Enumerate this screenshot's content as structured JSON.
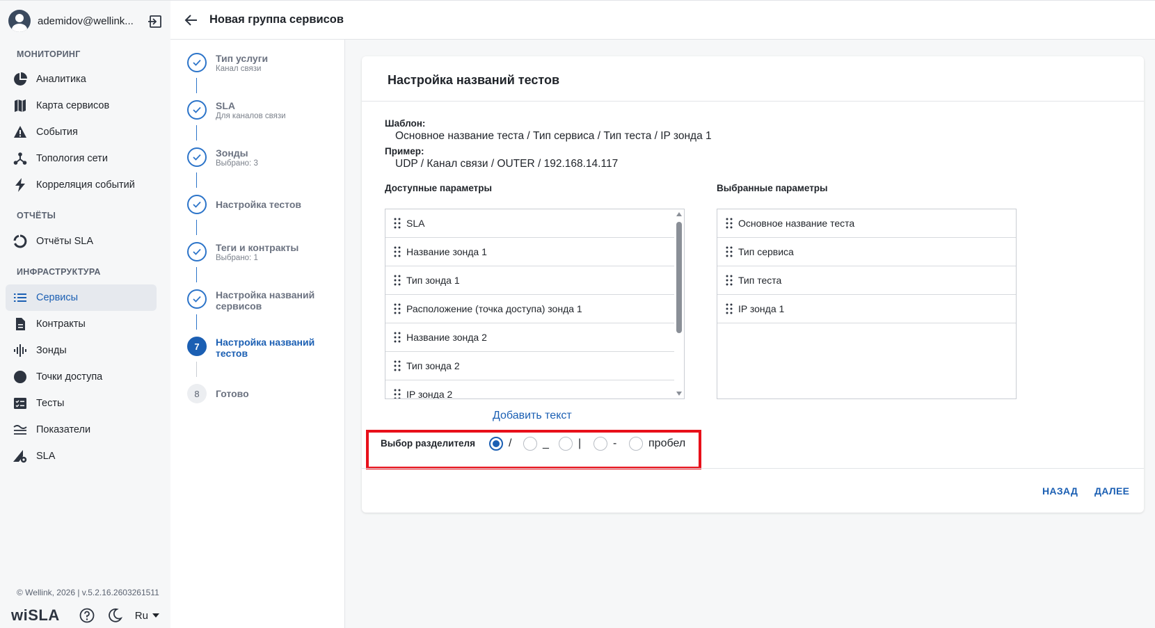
{
  "user": {
    "name": "ademidov@wellink..."
  },
  "sidebar": {
    "sections": [
      {
        "title": "МОНИТОРИНГ"
      },
      {
        "title": "ОТЧЁТЫ"
      },
      {
        "title": "ИНФРАСТРУКТУРА"
      }
    ],
    "items": [
      {
        "label": "Аналитика",
        "icon": "pie-chart-icon"
      },
      {
        "label": "Карта сервисов",
        "icon": "map-icon"
      },
      {
        "label": "События",
        "icon": "warning-icon"
      },
      {
        "label": "Топология сети",
        "icon": "topology-icon"
      },
      {
        "label": "Корреляция событий",
        "icon": "lightning-icon"
      },
      {
        "label": "Отчёты SLA",
        "icon": "circle-report-icon"
      },
      {
        "label": "Сервисы",
        "icon": "list-icon",
        "active": true
      },
      {
        "label": "Контракты",
        "icon": "document-icon"
      },
      {
        "label": "Зонды",
        "icon": "sound-wave-icon"
      },
      {
        "label": "Точки доступа",
        "icon": "dot-icon"
      },
      {
        "label": "Тесты",
        "icon": "checklist-icon"
      },
      {
        "label": "Показатели",
        "icon": "metrics-icon"
      },
      {
        "label": "SLA",
        "icon": "sla-gear-icon"
      }
    ],
    "footer": {
      "version": "© Wellink, 2026 | v.5.2.16.2603261511",
      "logo": "wiSLA",
      "lang": "Ru"
    }
  },
  "header": {
    "title": "Новая группа сервисов"
  },
  "stepper": {
    "steps": [
      {
        "title": "Тип услуги",
        "sub": "Канал связи",
        "state": "done"
      },
      {
        "title": "SLA",
        "sub": "Для каналов связи",
        "state": "done"
      },
      {
        "title": "Зонды",
        "sub": "Выбрано: 3",
        "state": "done"
      },
      {
        "title": "Настройка тестов",
        "sub": "",
        "state": "done"
      },
      {
        "title": "Теги и контракты",
        "sub": "Выбрано: 1",
        "state": "done"
      },
      {
        "title": "Настройка названий сервисов",
        "sub": "",
        "state": "done"
      },
      {
        "title": "Настройка названий тестов",
        "sub": "",
        "state": "active",
        "num": "7"
      },
      {
        "title": "Готово",
        "sub": "",
        "state": "pending",
        "num": "8"
      }
    ]
  },
  "card": {
    "title": "Настройка названий тестов",
    "template_label": "Шаблон:",
    "template_value": "Основное название теста / Тип сервиса / Тип теста / IP зонда 1",
    "example_label": "Пример:",
    "example_value": "UDP / Канал связи / OUTER / 192.168.14.117",
    "available_title": "Доступные параметры",
    "selected_title": "Выбранные параметры",
    "available": [
      "SLA",
      "Название зонда 1",
      "Тип зонда 1",
      "Расположение (точка доступа) зонда 1",
      "Название зонда 2",
      "Тип зонда 2",
      "IP зонда 2"
    ],
    "selected": [
      "Основное название теста",
      "Тип сервиса",
      "Тип теста",
      "IP зонда 1"
    ],
    "add_text": "Добавить текст",
    "separator_label": "Выбор разделителя",
    "separators": [
      {
        "label": "/",
        "checked": true
      },
      {
        "label": "_",
        "checked": false
      },
      {
        "label": "|",
        "checked": false
      },
      {
        "label": "-",
        "checked": false
      },
      {
        "label": "пробел",
        "checked": false
      }
    ],
    "back_label": "НАЗАД",
    "next_label": "ДАЛЕЕ"
  },
  "colors": {
    "accent": "#1b5fb3",
    "highlight": "#e8101a"
  }
}
